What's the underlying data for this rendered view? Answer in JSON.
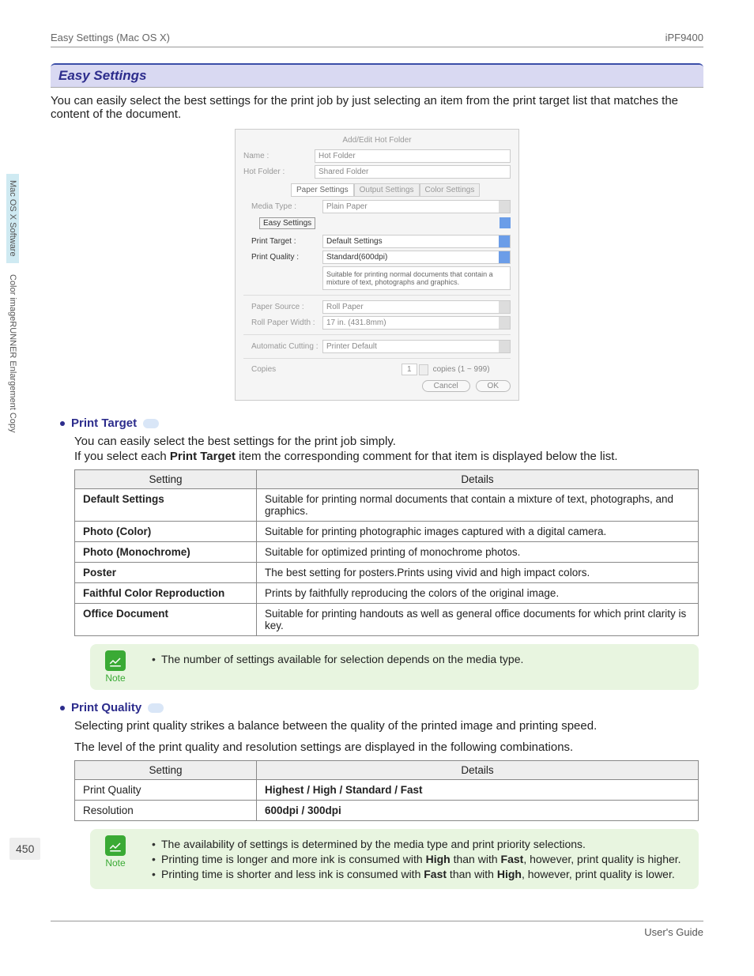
{
  "header": {
    "left": "Easy Settings (Mac OS X)",
    "right": "iPF9400"
  },
  "mainHeading": "Easy Settings",
  "intro": "You can easily select the best settings for the print job by just selecting an item from the print target list that matches the content of the document.",
  "dialog": {
    "title": "Add/Edit Hot Folder",
    "nameLabel": "Name :",
    "nameValue": "Hot Folder",
    "hotFolderLabel": "Hot Folder :",
    "hotFolderValue": "Shared Folder",
    "tabs": {
      "paper": "Paper Settings",
      "output": "Output Settings",
      "color": "Color Settings"
    },
    "mediaTypeLabel": "Media Type :",
    "mediaTypeValue": "Plain Paper",
    "easySettings": "Easy Settings",
    "printTargetLabel": "Print Target :",
    "printTargetValue": "Default Settings",
    "printQualityLabel": "Print Quality :",
    "printQualityValue": "Standard(600dpi)",
    "desc": "Suitable for printing normal documents that contain a mixture of text, photographs and graphics.",
    "paperSourceLabel": "Paper Source :",
    "paperSourceValue": "Roll Paper",
    "rollWidthLabel": "Roll Paper Width :",
    "rollWidthValue": "17 in. (431.8mm)",
    "autoCutLabel": "Automatic Cutting :",
    "autoCutValue": "Printer Default",
    "copiesLabel": "Copies",
    "copiesValue": "1",
    "copiesRange": "copies (1 ~ 999)",
    "cancel": "Cancel",
    "ok": "OK"
  },
  "printTarget": {
    "heading": "Print Target",
    "p1": "You can easily select the best settings for the print job simply.",
    "p2a": "If you select each ",
    "p2b": "Print Target",
    "p2c": " item the corresponding comment for that item is displayed below the list.",
    "thSetting": "Setting",
    "thDetails": "Details",
    "rows": [
      {
        "s": "Default Settings",
        "d": "Suitable for printing normal documents that contain a mixture of text, photographs, and graphics."
      },
      {
        "s": "Photo (Color)",
        "d": "Suitable for printing photographic images captured with a digital camera."
      },
      {
        "s": "Photo (Monochrome)",
        "d": "Suitable for optimized printing of monochrome photos."
      },
      {
        "s": "Poster",
        "d": "The best setting for posters.Prints using vivid and high impact colors."
      },
      {
        "s": "Faithful Color Reproduction",
        "d": "Prints by faithfully reproducing the colors of the original image."
      },
      {
        "s": "Office Document",
        "d": "Suitable for printing handouts as well as general office documents for which print clarity is key."
      }
    ],
    "note1": "The number of settings available for selection depends on the media type."
  },
  "printQuality": {
    "heading": "Print Quality",
    "p1": "Selecting print quality strikes a balance between the quality of the printed image and printing speed.",
    "p2": "The level of the print quality and resolution settings are displayed in the following combinations.",
    "thSetting": "Setting",
    "thDetails": "Details",
    "rows": [
      {
        "s": "Print Quality",
        "d": "Highest / High / Standard / Fast"
      },
      {
        "s": "Resolution",
        "d": "600dpi / 300dpi"
      }
    ],
    "notes": {
      "n1": "The availability of settings is determined by the media type and print priority selections.",
      "n2a": "Printing time is longer and more ink is consumed with ",
      "n2b": "High",
      "n2c": " than with ",
      "n2d": "Fast",
      "n2e": ", however, print quality is higher.",
      "n3a": "Printing time is shorter and less ink is consumed with ",
      "n3b": "Fast",
      "n3c": " than with ",
      "n3d": "High",
      "n3e": ", however, print quality is lower."
    }
  },
  "side": {
    "tab1": "Mac OS X Software",
    "tab2": "Color imageRUNNER Enlargement Copy"
  },
  "pageNum": "450",
  "footer": "User's Guide",
  "noteLabel": "Note"
}
